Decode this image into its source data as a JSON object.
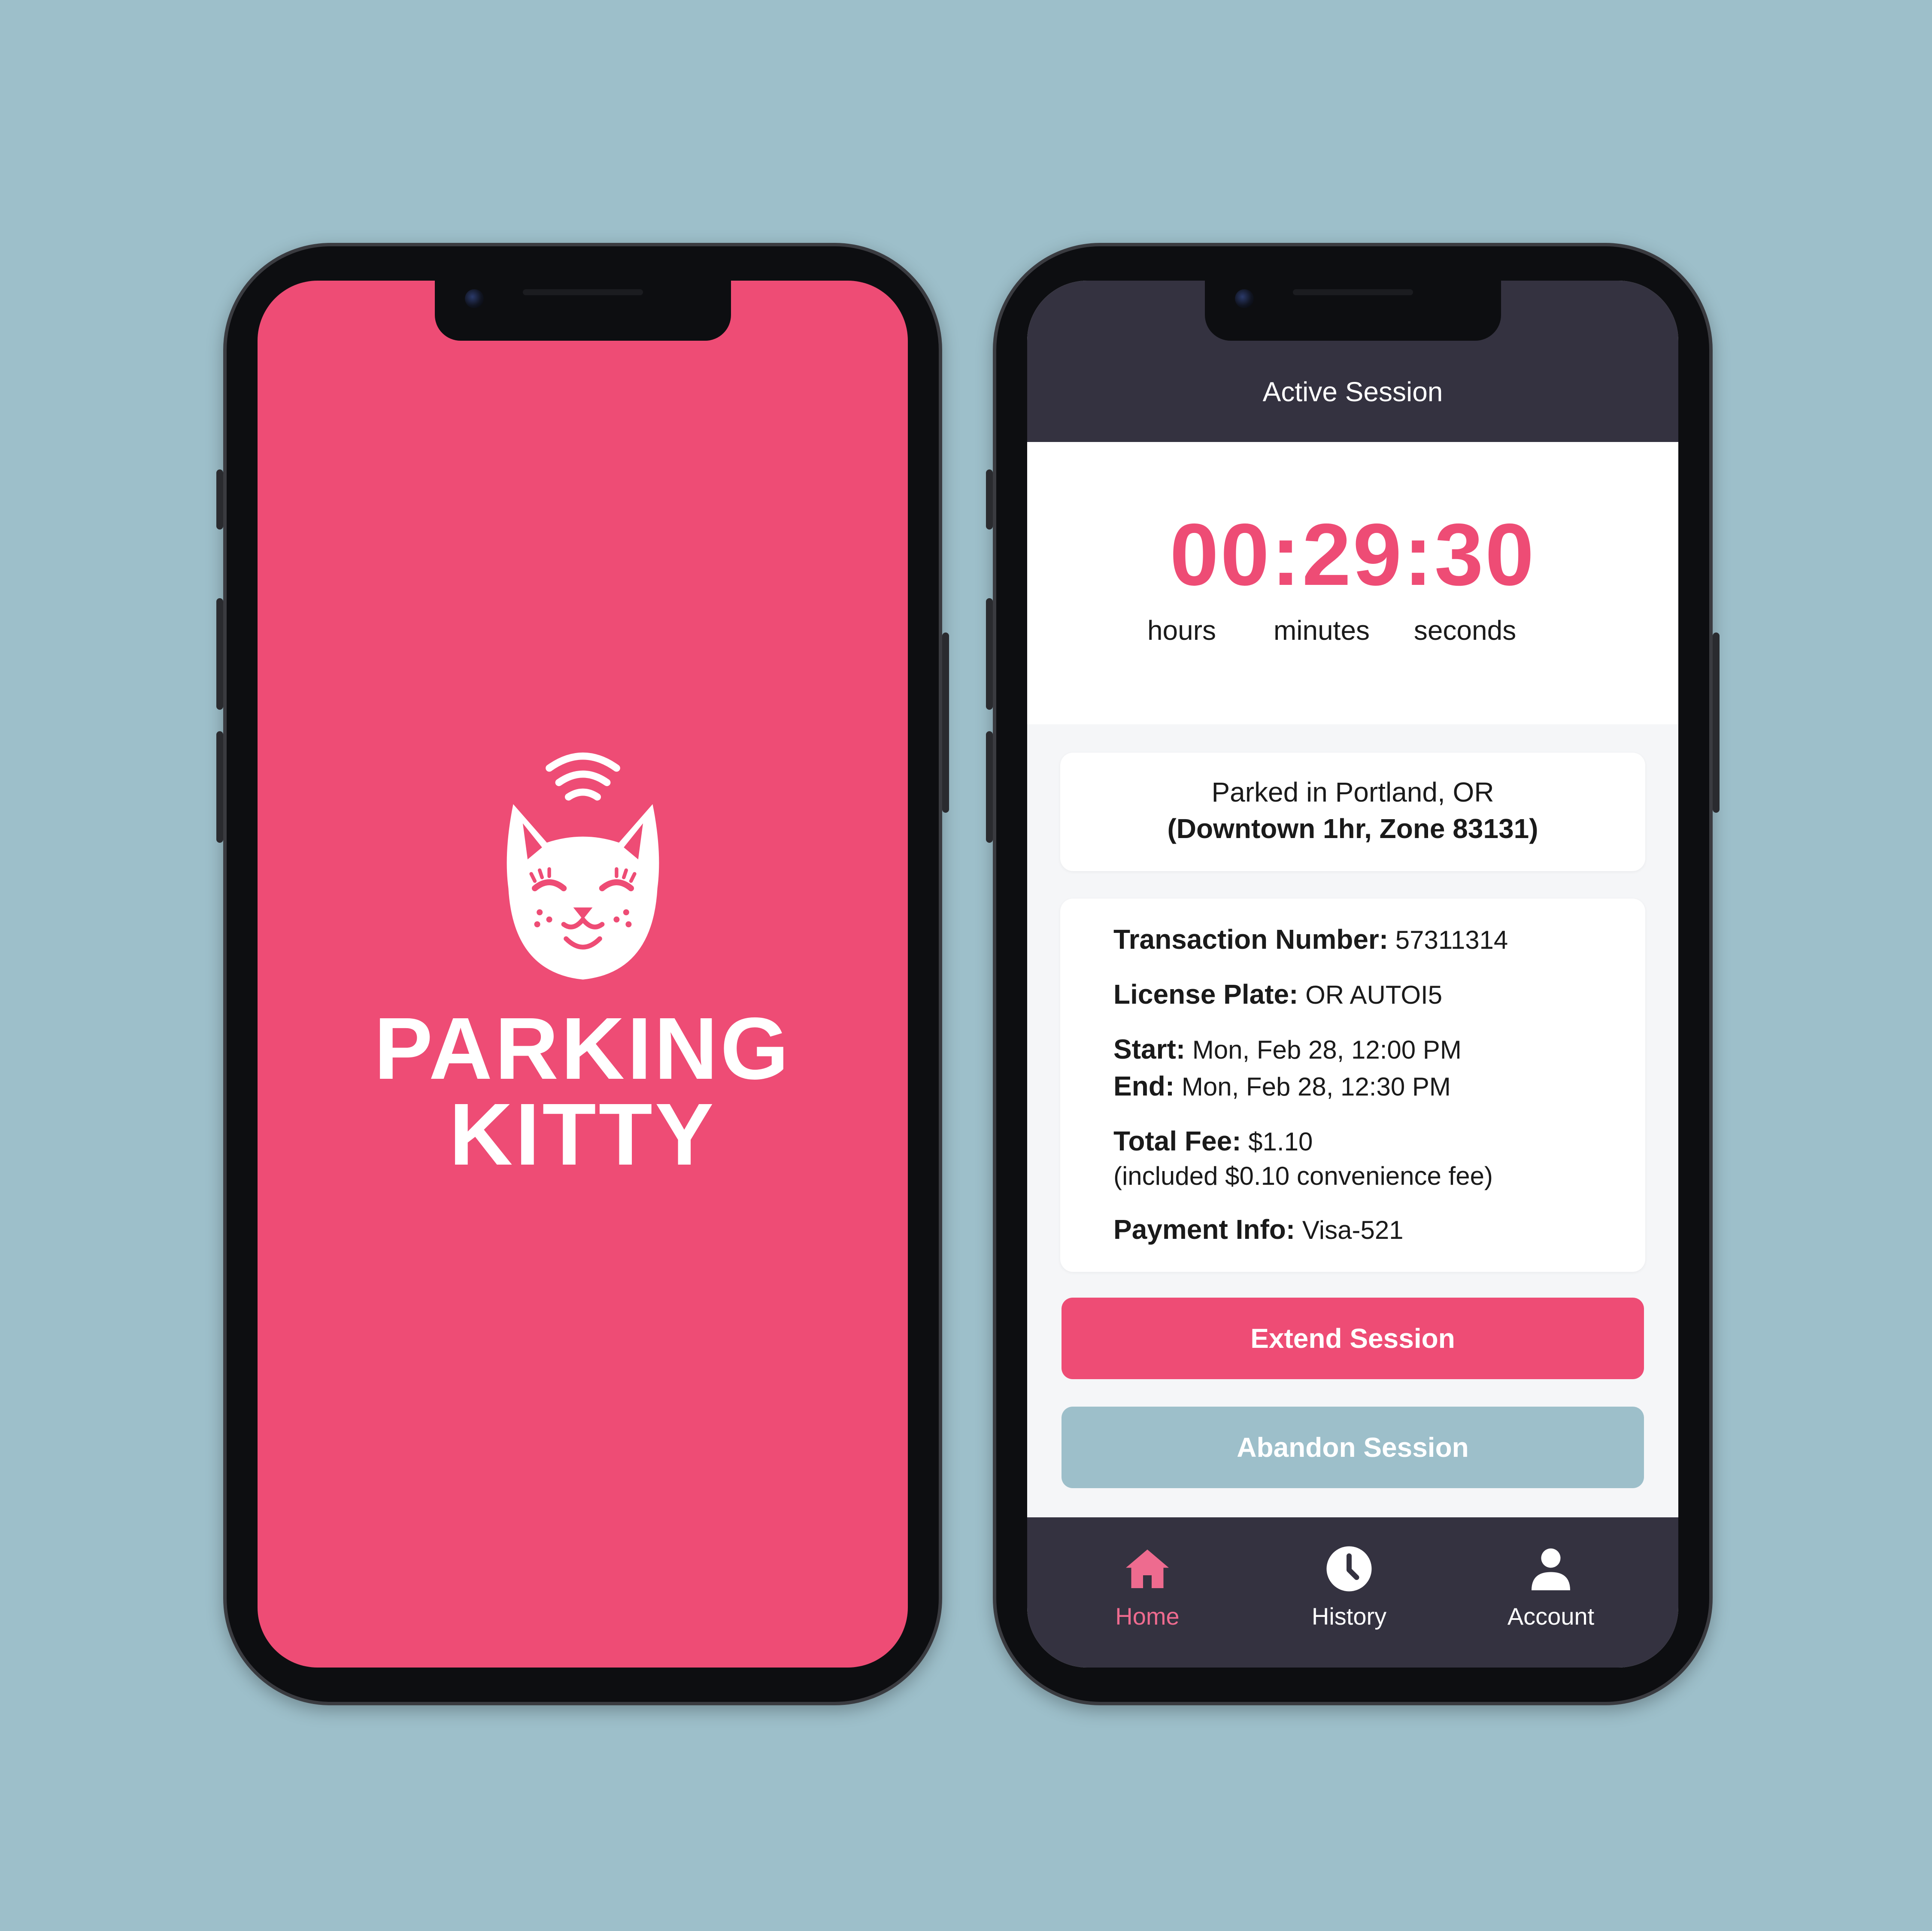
{
  "splash": {
    "brand_line1": "PARKING",
    "brand_line2": "KITTY",
    "icon": "cat-logo-icon"
  },
  "session": {
    "header_title": "Active Session",
    "timer": "00:29:30",
    "units": [
      "hours",
      "minutes",
      "seconds"
    ],
    "location_line1": "Parked in Portland, OR",
    "location_line2": "(Downtown 1hr, Zone 83131)",
    "details": {
      "transaction_label": "Transaction Number:",
      "transaction_value": "57311314",
      "plate_label": "License Plate:",
      "plate_value": "OR AUTOI5",
      "start_label": "Start:",
      "start_value": "Mon, Feb 28, 12:00 PM",
      "end_label": "End:",
      "end_value": "Mon, Feb 28, 12:30 PM",
      "fee_label": "Total Fee:",
      "fee_value": "$1.10",
      "fee_note": "(included $0.10 convenience fee)",
      "payment_label": "Payment Info:",
      "payment_value": "Visa-521"
    },
    "extend_label": "Extend Session",
    "abandon_label": "Abandon Session"
  },
  "tabbar": {
    "items": [
      {
        "label": "Home",
        "icon": "home-icon",
        "active": true
      },
      {
        "label": "History",
        "icon": "clock-icon",
        "active": false
      },
      {
        "label": "Account",
        "icon": "person-icon",
        "active": false
      }
    ]
  },
  "colors": {
    "background": "#9dbfca",
    "brand_pink": "#ee4c75",
    "dark_bar": "#343240",
    "secondary_button": "#9dbfca"
  }
}
